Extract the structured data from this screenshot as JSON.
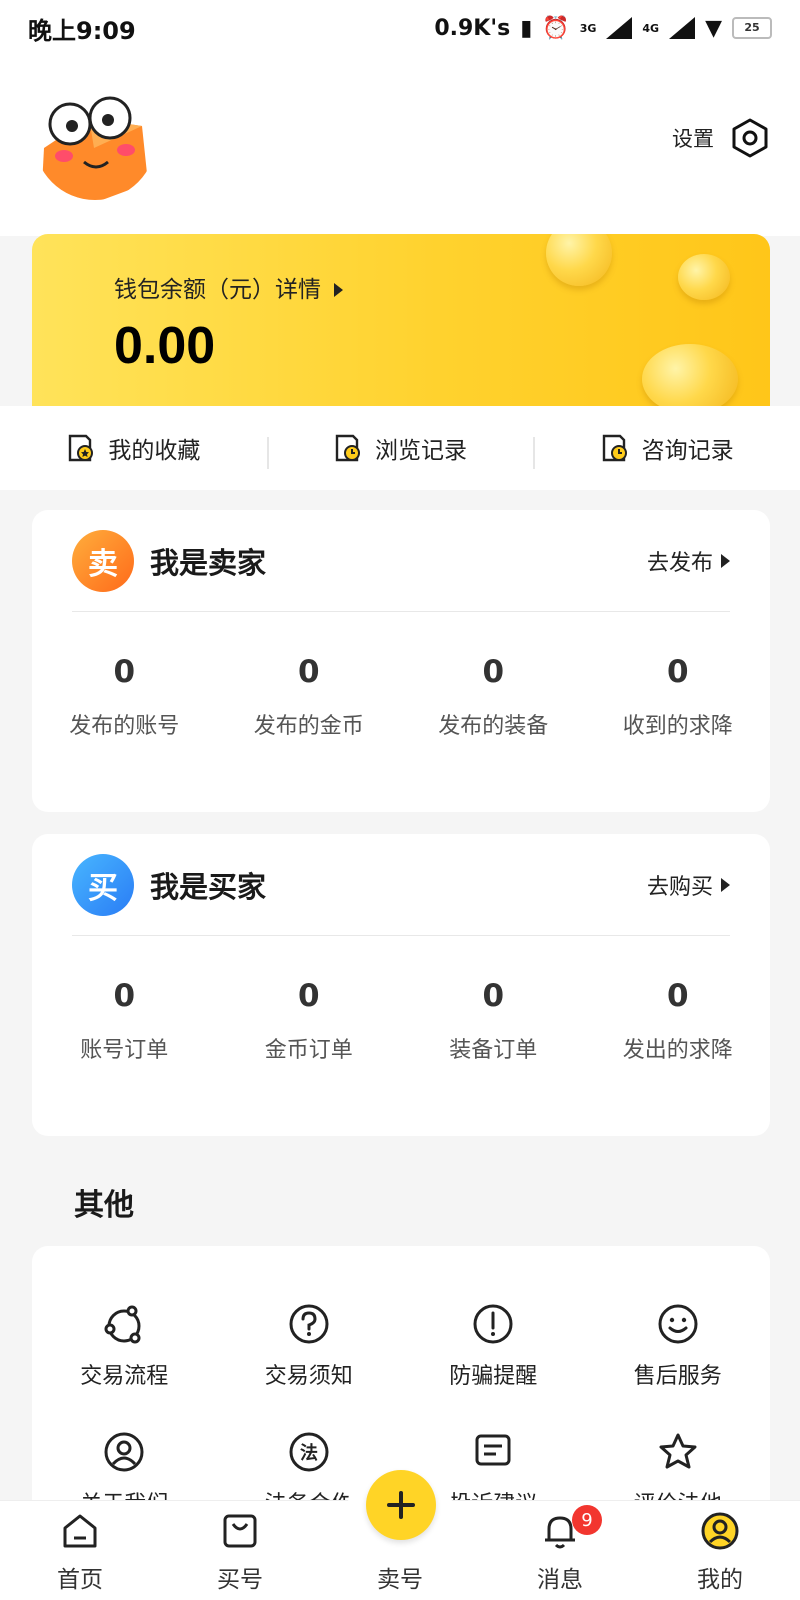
{
  "status_bar": {
    "time": "晚上9:09",
    "speed": "0.9K's",
    "net1": "3G",
    "net2": "4G",
    "battery": "25"
  },
  "header": {
    "settings_label": "设置"
  },
  "wallet": {
    "label": "钱包余额（元）详情",
    "balance": "0.00"
  },
  "quick_links": [
    {
      "label": "我的收藏",
      "icon": "favorites-icon"
    },
    {
      "label": "浏览记录",
      "icon": "history-icon"
    },
    {
      "label": "咨询记录",
      "icon": "consult-icon"
    }
  ],
  "seller": {
    "badge": "卖",
    "title": "我是卖家",
    "link": "去发布",
    "stats": [
      {
        "value": "0",
        "label": "发布的账号"
      },
      {
        "value": "0",
        "label": "发布的金币"
      },
      {
        "value": "0",
        "label": "发布的装备"
      },
      {
        "value": "0",
        "label": "收到的求降"
      }
    ]
  },
  "buyer": {
    "badge": "买",
    "title": "我是买家",
    "link": "去购买",
    "stats": [
      {
        "value": "0",
        "label": "账号订单"
      },
      {
        "value": "0",
        "label": "金币订单"
      },
      {
        "value": "0",
        "label": "装备订单"
      },
      {
        "value": "0",
        "label": "发出的求降"
      }
    ]
  },
  "other": {
    "title": "其他",
    "items": [
      {
        "label": "交易流程",
        "icon": "process-icon"
      },
      {
        "label": "交易须知",
        "icon": "question-icon"
      },
      {
        "label": "防骗提醒",
        "icon": "alert-icon"
      },
      {
        "label": "售后服务",
        "icon": "smile-icon"
      },
      {
        "label": "关于我们",
        "icon": "user-icon"
      },
      {
        "label": "法务合作",
        "icon": "law-icon"
      },
      {
        "label": "投诉建议",
        "icon": "feedback-icon"
      },
      {
        "label": "评价法他",
        "icon": "star-icon"
      }
    ]
  },
  "tabbar": {
    "tabs": [
      {
        "label": "首页",
        "icon": "home-icon"
      },
      {
        "label": "买号",
        "icon": "bag-icon"
      },
      {
        "label": "卖号",
        "icon": "plus-icon"
      },
      {
        "label": "消息",
        "icon": "bell-icon",
        "badge": "9"
      },
      {
        "label": "我的",
        "icon": "profile-icon"
      }
    ]
  },
  "colors": {
    "accent": "#ffd426",
    "seller_badge": "#ff7a1f",
    "buyer_badge": "#3a9bfa",
    "notification": "#f2362f"
  }
}
